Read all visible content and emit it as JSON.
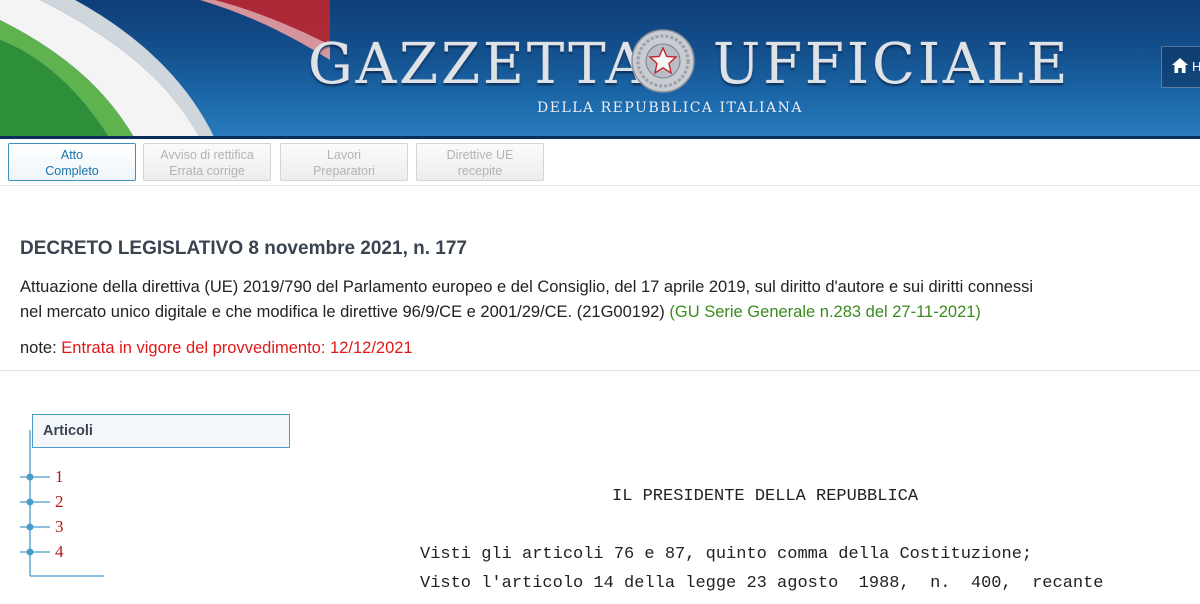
{
  "header": {
    "title_left": "GAZZETTA",
    "title_right": "UFFICIALE",
    "subtitle": "DELLA REPUBBLICA ITALIANA",
    "home_label": "H",
    "emblem_icon": "italian-republic-emblem-icon"
  },
  "tabs": [
    {
      "line1": "Atto",
      "line2": "Completo",
      "active": true
    },
    {
      "line1": "Avviso di rettifica",
      "line2": "Errata corrige",
      "active": false
    },
    {
      "line1": "Lavori",
      "line2": "Preparatori",
      "active": false
    },
    {
      "line1": "Direttive UE",
      "line2": "recepite",
      "active": false
    }
  ],
  "document": {
    "title": "DECRETO LEGISLATIVO 8 novembre 2021, n. 177",
    "description_line1": "Attuazione della direttiva (UE) 2019/790 del Parlamento europeo e del Consiglio, del 17 aprile 2019, sul diritto d'autore e sui diritti connessi",
    "description_line2": "nel mercato unico digitale e che modifica le direttive 96/9/CE e 2001/29/CE. (21G00192) ",
    "gu_reference": "(GU Serie Generale n.283 del 27-11-2021)",
    "note_label": "note: ",
    "note_value": "Entrata in vigore del provvedimento: 12/12/2021"
  },
  "articoli": {
    "heading": "Articoli",
    "items": [
      "1",
      "2",
      "3",
      "4"
    ]
  },
  "act_text": {
    "heading": "IL PRESIDENTE DELLA REPUBBLICA",
    "line1": "Visti gli articoli 76 e 87, quinto comma della Costituzione;",
    "line2": "Visto l'articolo 14 della legge 23 agosto  1988,  n.  400,  recante"
  },
  "colors": {
    "banner_blue": "#14528f",
    "tab_active_border": "#3f8fbf",
    "gu_reference_green": "#3a8c1e",
    "note_red": "#e01818",
    "article_link_red": "#b01818"
  }
}
